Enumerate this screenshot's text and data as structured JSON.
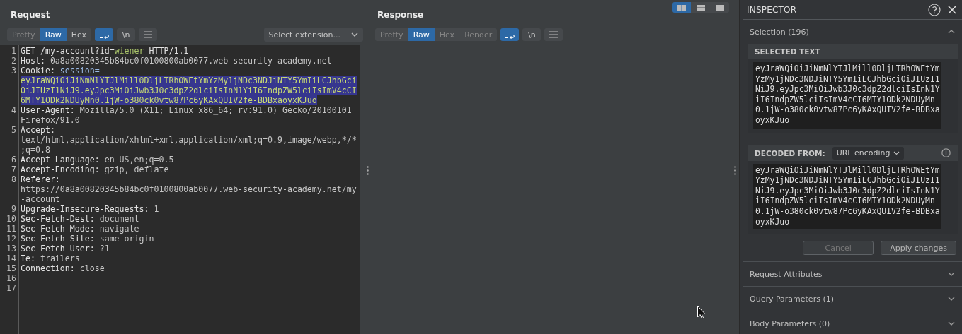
{
  "request": {
    "title": "Request",
    "view_tabs": [
      {
        "label": "Pretty",
        "selected": false,
        "disabled": true
      },
      {
        "label": "Raw",
        "selected": true,
        "disabled": false
      },
      {
        "label": "Hex",
        "selected": false,
        "disabled": false
      }
    ],
    "toolbar": [
      {
        "kind": "wrap",
        "on": true
      },
      {
        "kind": "newline",
        "label": "\\n",
        "on": false
      },
      {
        "kind": "menu",
        "on": false
      }
    ],
    "extension_select": "Select extension...",
    "lines": [
      {
        "number": "1",
        "rows": [
          [
            {
              "text": "GET /my-account?id=",
              "kind": "name"
            },
            {
              "text": "wiener",
              "kind": "param"
            },
            {
              "text": " HTTP/1.1",
              "kind": "name"
            }
          ]
        ]
      },
      {
        "number": "2",
        "rows": [
          [
            {
              "text": "Host:",
              "kind": "name"
            },
            {
              "text": " 0a8a00820345b84bc0f0100800ab0077.web-security-academy.net",
              "kind": "value"
            }
          ]
        ]
      },
      {
        "number": "3",
        "rows": [
          [
            {
              "text": "Cookie:",
              "kind": "name"
            },
            {
              "text": " ",
              "kind": "value"
            },
            {
              "text": "session=",
              "kind": "param_name"
            }
          ],
          [
            {
              "text": "eyJraWQiOiJiNmNlYTJlMill0DljLTRhOWEtYmYzMy1jNDc3NDJiNTY5YmIiLCJhbGci",
              "kind": "selected"
            }
          ],
          [
            {
              "text": "OiJIUzI1NiJ9.eyJpc3MiOiJwb3J0c3dpZ2dlciIsInN1YiI6IndpZW5lciIsImV4cCI",
              "kind": "selected"
            }
          ],
          [
            {
              "text": "6MTY1ODk2NDUyMn0.1jW-o380ck0vtw87Pc6yKAxQUIV2fe-BDBxaoyxKJuo",
              "kind": "selected"
            }
          ]
        ]
      },
      {
        "number": "4",
        "rows": [
          [
            {
              "text": "User-Agent:",
              "kind": "name"
            },
            {
              "text": " Mozilla/5.0 (X11; Linux x86_64; rv:91.0) Gecko/20100101",
              "kind": "value"
            }
          ],
          [
            {
              "text": "Firefox/91.0",
              "kind": "value"
            }
          ]
        ]
      },
      {
        "number": "5",
        "rows": [
          [
            {
              "text": "Accept:",
              "kind": "name"
            }
          ],
          [
            {
              "text": "text/html,application/xhtml+xml,application/xml;q=0.9,image/webp,*/*",
              "kind": "value"
            }
          ],
          [
            {
              "text": ";q=0.8",
              "kind": "value"
            }
          ]
        ]
      },
      {
        "number": "6",
        "rows": [
          [
            {
              "text": "Accept-Language:",
              "kind": "name"
            },
            {
              "text": " en-US,en;q=0.5",
              "kind": "value"
            }
          ]
        ]
      },
      {
        "number": "7",
        "rows": [
          [
            {
              "text": "Accept-Encoding:",
              "kind": "name"
            },
            {
              "text": " gzip, deflate",
              "kind": "value"
            }
          ]
        ]
      },
      {
        "number": "8",
        "rows": [
          [
            {
              "text": "Referer:",
              "kind": "name"
            }
          ],
          [
            {
              "text": "https://0a8a00820345b84bc0f0100800ab0077.web-security-academy.net/my",
              "kind": "value"
            }
          ],
          [
            {
              "text": "-account",
              "kind": "value"
            }
          ]
        ]
      },
      {
        "number": "9",
        "rows": [
          [
            {
              "text": "Upgrade-Insecure-Requests:",
              "kind": "name"
            },
            {
              "text": " 1",
              "kind": "value"
            }
          ]
        ]
      },
      {
        "number": "10",
        "rows": [
          [
            {
              "text": "Sec-Fetch-Dest:",
              "kind": "name"
            },
            {
              "text": " document",
              "kind": "value"
            }
          ]
        ]
      },
      {
        "number": "11",
        "rows": [
          [
            {
              "text": "Sec-Fetch-Mode:",
              "kind": "name"
            },
            {
              "text": " navigate",
              "kind": "value"
            }
          ]
        ]
      },
      {
        "number": "12",
        "rows": [
          [
            {
              "text": "Sec-Fetch-Site:",
              "kind": "name"
            },
            {
              "text": " same-origin",
              "kind": "value"
            }
          ]
        ]
      },
      {
        "number": "13",
        "rows": [
          [
            {
              "text": "Sec-Fetch-User:",
              "kind": "name"
            },
            {
              "text": " ?1",
              "kind": "value"
            }
          ]
        ]
      },
      {
        "number": "14",
        "rows": [
          [
            {
              "text": "Te:",
              "kind": "name"
            },
            {
              "text": " trailers",
              "kind": "value"
            }
          ]
        ]
      },
      {
        "number": "15",
        "rows": [
          [
            {
              "text": "Connection:",
              "kind": "name"
            },
            {
              "text": " close",
              "kind": "value"
            }
          ]
        ]
      },
      {
        "number": "16"
      },
      {
        "number": "17"
      }
    ]
  },
  "response": {
    "title": "Response",
    "view_tabs": [
      {
        "label": "Pretty",
        "selected": false,
        "disabled": true
      },
      {
        "label": "Raw",
        "selected": true,
        "disabled": false
      },
      {
        "label": "Hex",
        "selected": false,
        "disabled": true
      },
      {
        "label": "Render",
        "selected": false,
        "disabled": true
      }
    ],
    "toolbar": [
      {
        "kind": "wrap",
        "on": true
      },
      {
        "kind": "newline",
        "label": "\\n",
        "on": false
      },
      {
        "kind": "menu",
        "on": false
      }
    ]
  },
  "layout_buttons": [
    {
      "kind": "side_by_side",
      "selected": true
    },
    {
      "kind": "stacked",
      "selected": false
    },
    {
      "kind": "single",
      "selected": false
    }
  ],
  "inspector": {
    "title": "INSPECTOR",
    "selection": {
      "label": "Selection (196)",
      "expanded": true,
      "selected_text": {
        "heading": "SELECTED TEXT",
        "value": "eyJraWQiOiJiNmNlYTJlMill0DljLTRhOWEtYmYzMy1jNDc3NDJiNTY5YmIiLCJhbGciOiJIUzI1NiJ9.eyJpc3MiOiJwb3J0c3dpZ2dlciIsInN1YiI6IndpZW5lciIsImV4cCI6MTY1ODk2NDUyMn0.1jW-o380ck0vtw87Pc6yKAxQUIV2fe-BDBxaoyxKJuo"
      },
      "decoded": {
        "heading": "DECODED FROM:",
        "encoding": "URL encoding",
        "value": "eyJraWQiOiJiNmNlYTJlMill0DljLTRhOWEtYmYzMy1jNDc3NDJiNTY5YmIiLCJhbGciOiJIUzI1NiJ9.eyJpc3MiOiJwb3J0c3dpZ2dlciIsInN1YiI6IndpZW5lciIsImV4cCI6MTY1ODk2NDUyMn0.1jW-o380ck0vtw87Pc6yKAxQUIV2fe-BDBxaoyxKJuo"
      },
      "buttons": [
        {
          "label": "Cancel",
          "disabled": true
        },
        {
          "label": "Apply changes",
          "disabled": false
        }
      ]
    },
    "sections": [
      {
        "label": "Request Attributes",
        "expanded": false
      },
      {
        "label": "Query Parameters (1)",
        "expanded": false
      },
      {
        "label": "Body Parameters (0)",
        "expanded": false
      }
    ]
  }
}
